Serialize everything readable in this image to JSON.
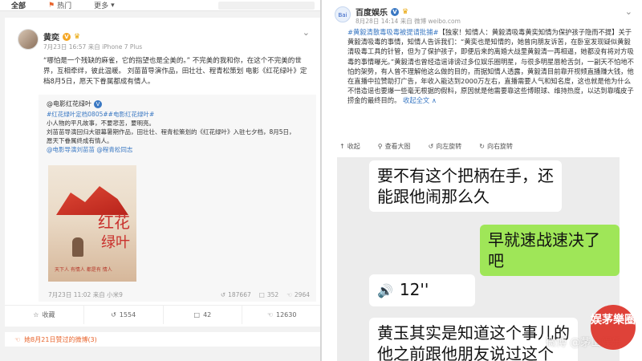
{
  "left": {
    "tabs": [
      {
        "label": "全部",
        "icon": "none"
      },
      {
        "label": "热门",
        "icon": "flame-icon"
      },
      {
        "label": "更多",
        "icon": "chevron-down-icon"
      }
    ],
    "post": {
      "author": "黄奕",
      "meta": "7月23日 16:57 来自 iPhone 7 Plus",
      "text": "“哪怕是一个残缺的麻雀，它的指望也是全美的。” 不完美的我和你，在这个不完美的世界，互相牵绊，彼此温暖。 刘苗苗导演作品，田壮壮、程青松策划 电影《红花绿叶》定档8月5日，愿天下眷属都成有情人。",
      "repost": {
        "author": "@电影红花绿叶",
        "tags": "#红花绿叶定档0805##电影红花绿叶#",
        "lines": [
          "小人物的平凡故事，不要悲苦，要明亮。",
          "刘苗苗导演回归大银幕暑期作品，田壮壮、程青松策划的《红花绿叶》入驻七夕档，8月5日，",
          "愿天下眷属终成有情人。"
        ],
        "mentions": "@电影导演刘苗苗 @程青松同志",
        "poster": {
          "title_top": "红花",
          "title_bottom": "绿叶",
          "note": "天下人 有情人 都是有 情人"
        },
        "footer_time": "7月23日 11:02 来自 小米9",
        "stats": {
          "reposts": "187667",
          "comments": "352",
          "likes": "2964"
        }
      },
      "actions": [
        {
          "label": "收藏",
          "icon": "star-icon"
        },
        {
          "label": "1554",
          "icon": "repost-icon"
        },
        {
          "label": "42",
          "icon": "comment-icon"
        },
        {
          "label": "12630",
          "icon": "like-icon"
        }
      ],
      "liked_by": "她8月21日赞过的微博(3)"
    }
  },
  "right": {
    "author": "百度娱乐",
    "meta": "8月28日 14:14 来自 微博 weibo.com",
    "avatar_text": "Bai",
    "tag": "#黄毅清散毒吸毒被提请批捕#",
    "text": "【独家！知情人：黄毅清吸毒黄奕知情为保护孩子隐而不提】关于黄毅清吸毒的事情，知情人告诉我们：“黄奕也是知情的，她曾向朋友诉苦，在卧室发现疑似黄毅清吸毒工具的针管，但为了保护孩子，即便后来的离婚大战里黄毅清一再相逼，她都没有将对方吸毒的事情曝光。”黄毅清也曾经造谣诽谤过多位娱乐圈明星，与很多明星唇枪舌剑，一副天不怕地不怕的架势，有人曾不理解他这么做的目的，而据知情人透露，黄毅清目前靠开视频直播赚大钱，他在直播中拉赞助打广告，年收入能达到2000万左右，直播需要人气和知名度，这也就是他为什么不惜造谣也要爆一些毫无根据的假料，原因就是他需要靠这些博眼球、维持热度，以达到靠嘴皮子捞金的最终目的。",
    "more": "收起全文 ∧",
    "actions": [
      {
        "label": "收起",
        "icon": "collapse-icon"
      },
      {
        "label": "查看大图",
        "icon": "magnify-icon"
      },
      {
        "label": "向左旋转",
        "icon": "rotate-left-icon"
      },
      {
        "label": "向右旋转",
        "icon": "rotate-right-icon"
      }
    ],
    "chat": {
      "msg1": "要不有这个把柄在手，还能跟他闹那么久",
      "msg2": "早就速战速决了吧",
      "voice": "12''",
      "msg3": "黄玉其实是知道这个事儿的 他之前跟他朋友说过这个"
    },
    "watermark": "娱茅樂圈",
    "watermark_text": "微博 @茅山娱乐"
  },
  "colors": {
    "link": "#3a78c3",
    "green_bubble": "#9fe658",
    "accent": "#e8632b"
  }
}
